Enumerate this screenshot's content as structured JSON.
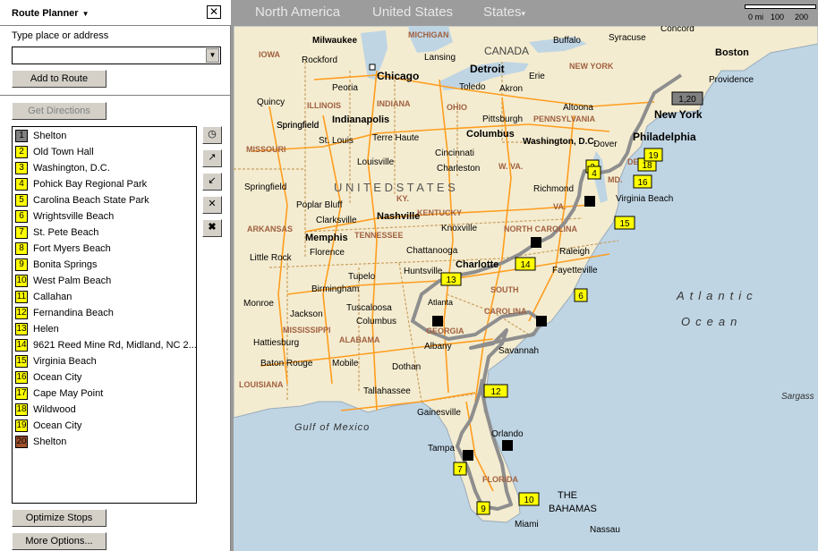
{
  "panel": {
    "title": "Route Planner",
    "close_glyph": "✕",
    "address_label": "Type place or address",
    "address_value": "",
    "add_button": "Add to Route",
    "directions_button": "Get Directions",
    "optimize_button": "Optimize Stops",
    "more_button": "More Options...",
    "tool_icons": [
      "clock-icon",
      "move-up-icon",
      "move-down-icon",
      "remove-stop-icon",
      "clear-route-icon"
    ],
    "stops": [
      {
        "num": "1",
        "name": "Shelton",
        "color": "#808080"
      },
      {
        "num": "2",
        "name": "Old Town Hall",
        "color": "#ffff00"
      },
      {
        "num": "3",
        "name": "Washington, D.C.",
        "color": "#ffff00"
      },
      {
        "num": "4",
        "name": "Pohick Bay Regional Park",
        "color": "#ffff00"
      },
      {
        "num": "5",
        "name": "Carolina Beach State Park",
        "color": "#ffff00"
      },
      {
        "num": "6",
        "name": "Wrightsville Beach",
        "color": "#ffff00"
      },
      {
        "num": "7",
        "name": "St. Pete Beach",
        "color": "#ffff00"
      },
      {
        "num": "8",
        "name": "Fort Myers Beach",
        "color": "#ffff00"
      },
      {
        "num": "9",
        "name": "Bonita Springs",
        "color": "#ffff00"
      },
      {
        "num": "10",
        "name": "West Palm Beach",
        "color": "#ffff00"
      },
      {
        "num": "11",
        "name": "Callahan",
        "color": "#ffff00"
      },
      {
        "num": "12",
        "name": "Fernandina Beach",
        "color": "#ffff00"
      },
      {
        "num": "13",
        "name": "Helen",
        "color": "#ffff00"
      },
      {
        "num": "14",
        "name": "9621 Reed Mine Rd, Midland, NC 2...",
        "color": "#ffff00"
      },
      {
        "num": "15",
        "name": "Virginia Beach",
        "color": "#ffff00"
      },
      {
        "num": "16",
        "name": "Ocean City",
        "color": "#ffff00"
      },
      {
        "num": "17",
        "name": "Cape May Point",
        "color": "#ffff00"
      },
      {
        "num": "18",
        "name": "Wildwood",
        "color": "#ffff00"
      },
      {
        "num": "19",
        "name": "Ocean City",
        "color": "#ffff00"
      },
      {
        "num": "20",
        "name": "Shelton",
        "color": "#a0522d"
      }
    ]
  },
  "map": {
    "breadcrumb": [
      "North America",
      "United States",
      "States"
    ],
    "scale_labels": [
      "0 mi",
      "100",
      "200"
    ],
    "colors": {
      "land": "#f4ecd0",
      "water": "#bfd5e4",
      "road": "#ff9d1e",
      "route": "#8e8e8e",
      "border": "#c8a060"
    },
    "water_labels": [
      "Atlantic",
      "Ocean",
      "Gulf of Mexico",
      "Sargass"
    ],
    "country_labels": [
      "CANADA",
      "U N I T E D   S T A T E S",
      "THE",
      "BAHAMAS"
    ],
    "state_labels": [
      "MICHIGAN",
      "IOWA",
      "ILLINOIS",
      "INDIANA",
      "OHIO",
      "PENNSYLVANIA",
      "NEW YORK",
      "MISSOURI",
      "KENTUCKY",
      "W. VA.",
      "VA.",
      "TENNESSEE",
      "NORTH CAROLINA",
      "ARKANSAS",
      "SOUTH",
      "CAROLINA",
      "MISSISSIPPI",
      "ALABAMA",
      "GEORGIA",
      "LOUISIANA",
      "FLORIDA",
      "KY.",
      "MD.",
      "DEL."
    ],
    "cities_major": [
      "Chicago",
      "Detroit",
      "Philadelphia",
      "New York",
      "Boston",
      "Washington, D.C.",
      "Nashville",
      "Memphis",
      "Charlotte",
      "Columbus",
      "Indianapolis",
      "Atlanta"
    ],
    "cities": [
      "Milwaukee",
      "Rockford",
      "Lansing",
      "Toledo",
      "Akron",
      "Erie",
      "Buffalo",
      "Syracuse",
      "Concord",
      "Providence",
      "Peoria",
      "Quincy",
      "Springfield",
      "St. Louis",
      "Terre Haute",
      "Louisville",
      "Cincinnati",
      "Charleston",
      "Pittsburgh",
      "Altoona",
      "Dover",
      "Richmond",
      "Virginia Beach",
      "Knoxville",
      "Raleigh",
      "Fayetteville",
      "Chattanooga",
      "Huntsville",
      "Poplar Bluff",
      "Clarksville",
      "Florence",
      "Tupelo",
      "Birmingham",
      "Little Rock",
      "Monroe",
      "Jackson",
      "Tuscaloosa",
      "Columbus",
      "Albany",
      "Hattiesburg",
      "Mobile",
      "Baton Rouge",
      "Dothan",
      "Tallahassee",
      "Savannah",
      "Gainesville",
      "Orlando",
      "Tampa",
      "Miami",
      "Nassau",
      "Springfield",
      "Springfield"
    ],
    "markers": [
      {
        "label": "1,20",
        "style": "gray"
      },
      {
        "label": "2",
        "style": "yellow"
      },
      {
        "label": "4",
        "style": "yellow"
      },
      {
        "label": "16",
        "style": "yellow"
      },
      {
        "label": "18",
        "style": "yellow"
      },
      {
        "label": "19",
        "style": "yellow"
      },
      {
        "label": "15",
        "style": "yellow"
      },
      {
        "label": "14",
        "style": "yellow"
      },
      {
        "label": "13",
        "style": "yellow"
      },
      {
        "label": "6",
        "style": "yellow"
      },
      {
        "label": "12",
        "style": "yellow"
      },
      {
        "label": "7",
        "style": "yellow"
      },
      {
        "label": "9",
        "style": "yellow"
      },
      {
        "label": "10",
        "style": "yellow"
      }
    ]
  }
}
